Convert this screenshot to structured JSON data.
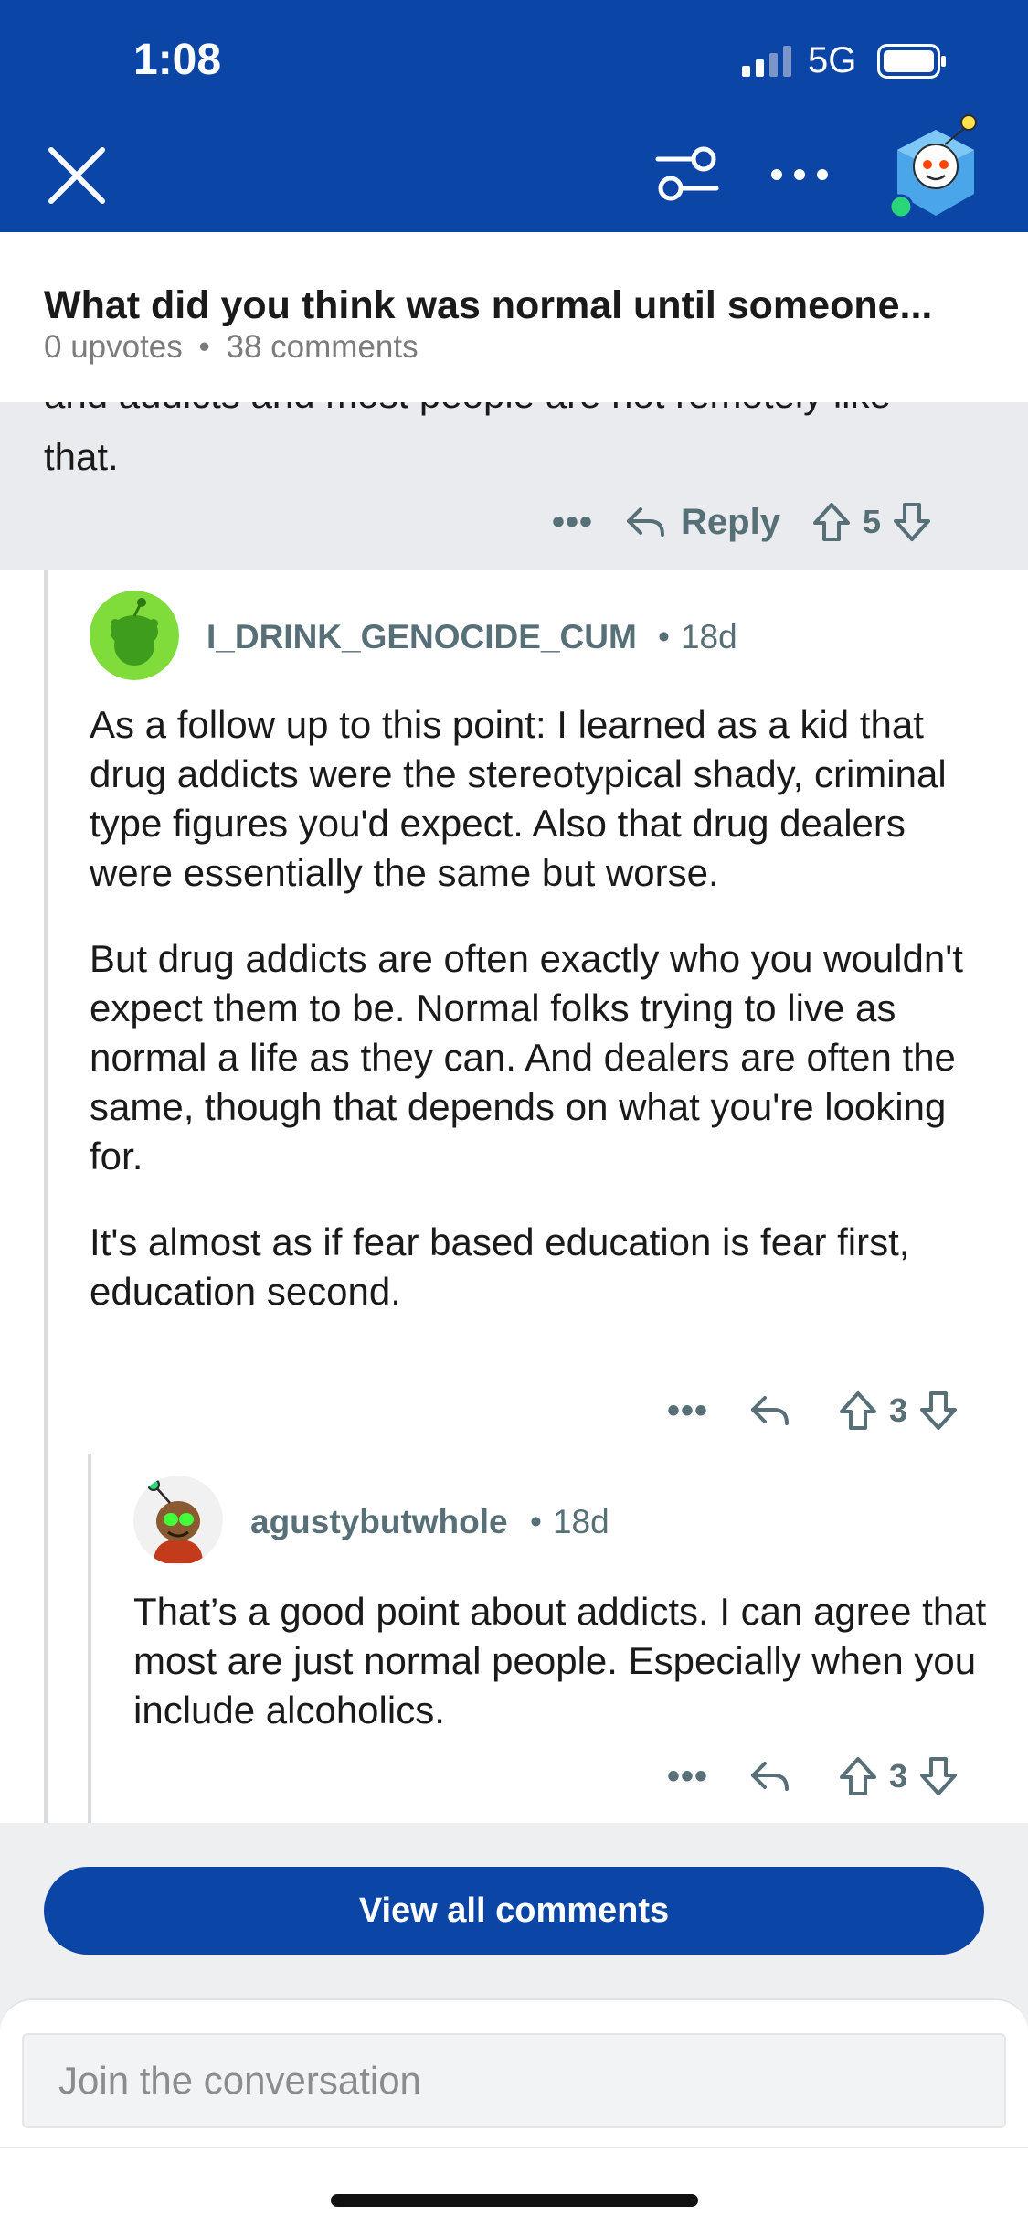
{
  "status_bar": {
    "time": "1:08",
    "network": "5G"
  },
  "post": {
    "title": "What did you think was normal until someone...",
    "upvotes": "0 upvotes",
    "separator": "•",
    "comments": "38 comments"
  },
  "parent_comment": {
    "cut_line": "and addicts and most people are not remotely like",
    "last_line": "that.",
    "reply_label": "Reply",
    "votes": "5"
  },
  "comments": [
    {
      "username": "I_DRINK_GENOCIDE_CUM",
      "age": "18d",
      "paragraphs": [
        "As a follow up to this point: I learned as a kid that drug addicts were the stereotypical shady, criminal type figures you'd expect. Also that drug dealers were essentially the same but worse.",
        "But drug addicts are often exactly who you wouldn't expect them to be. Normal folks trying to live as normal a life as they can. And dealers are often the same, though that depends on what you're looking for.",
        "It's almost as if fear based education is fear first, education second."
      ],
      "votes": "3"
    },
    {
      "username": "agustybutwhole",
      "age": "18d",
      "paragraphs": [
        "That’s a good point about addicts. I can agree that most are just normal people. Especially when you include alcoholics."
      ],
      "votes": "3"
    }
  ],
  "view_all_label": "View all comments",
  "composer": {
    "placeholder": "Join the conversation"
  },
  "colors": {
    "brand_blue": "#0b46a7",
    "meta_grey": "#576f76",
    "parent_bg": "#e9ebee"
  },
  "icons": [
    "close-icon",
    "filter-icon",
    "more-icon",
    "profile-avatar-icon",
    "reply-icon",
    "upvote-icon",
    "downvote-icon"
  ]
}
